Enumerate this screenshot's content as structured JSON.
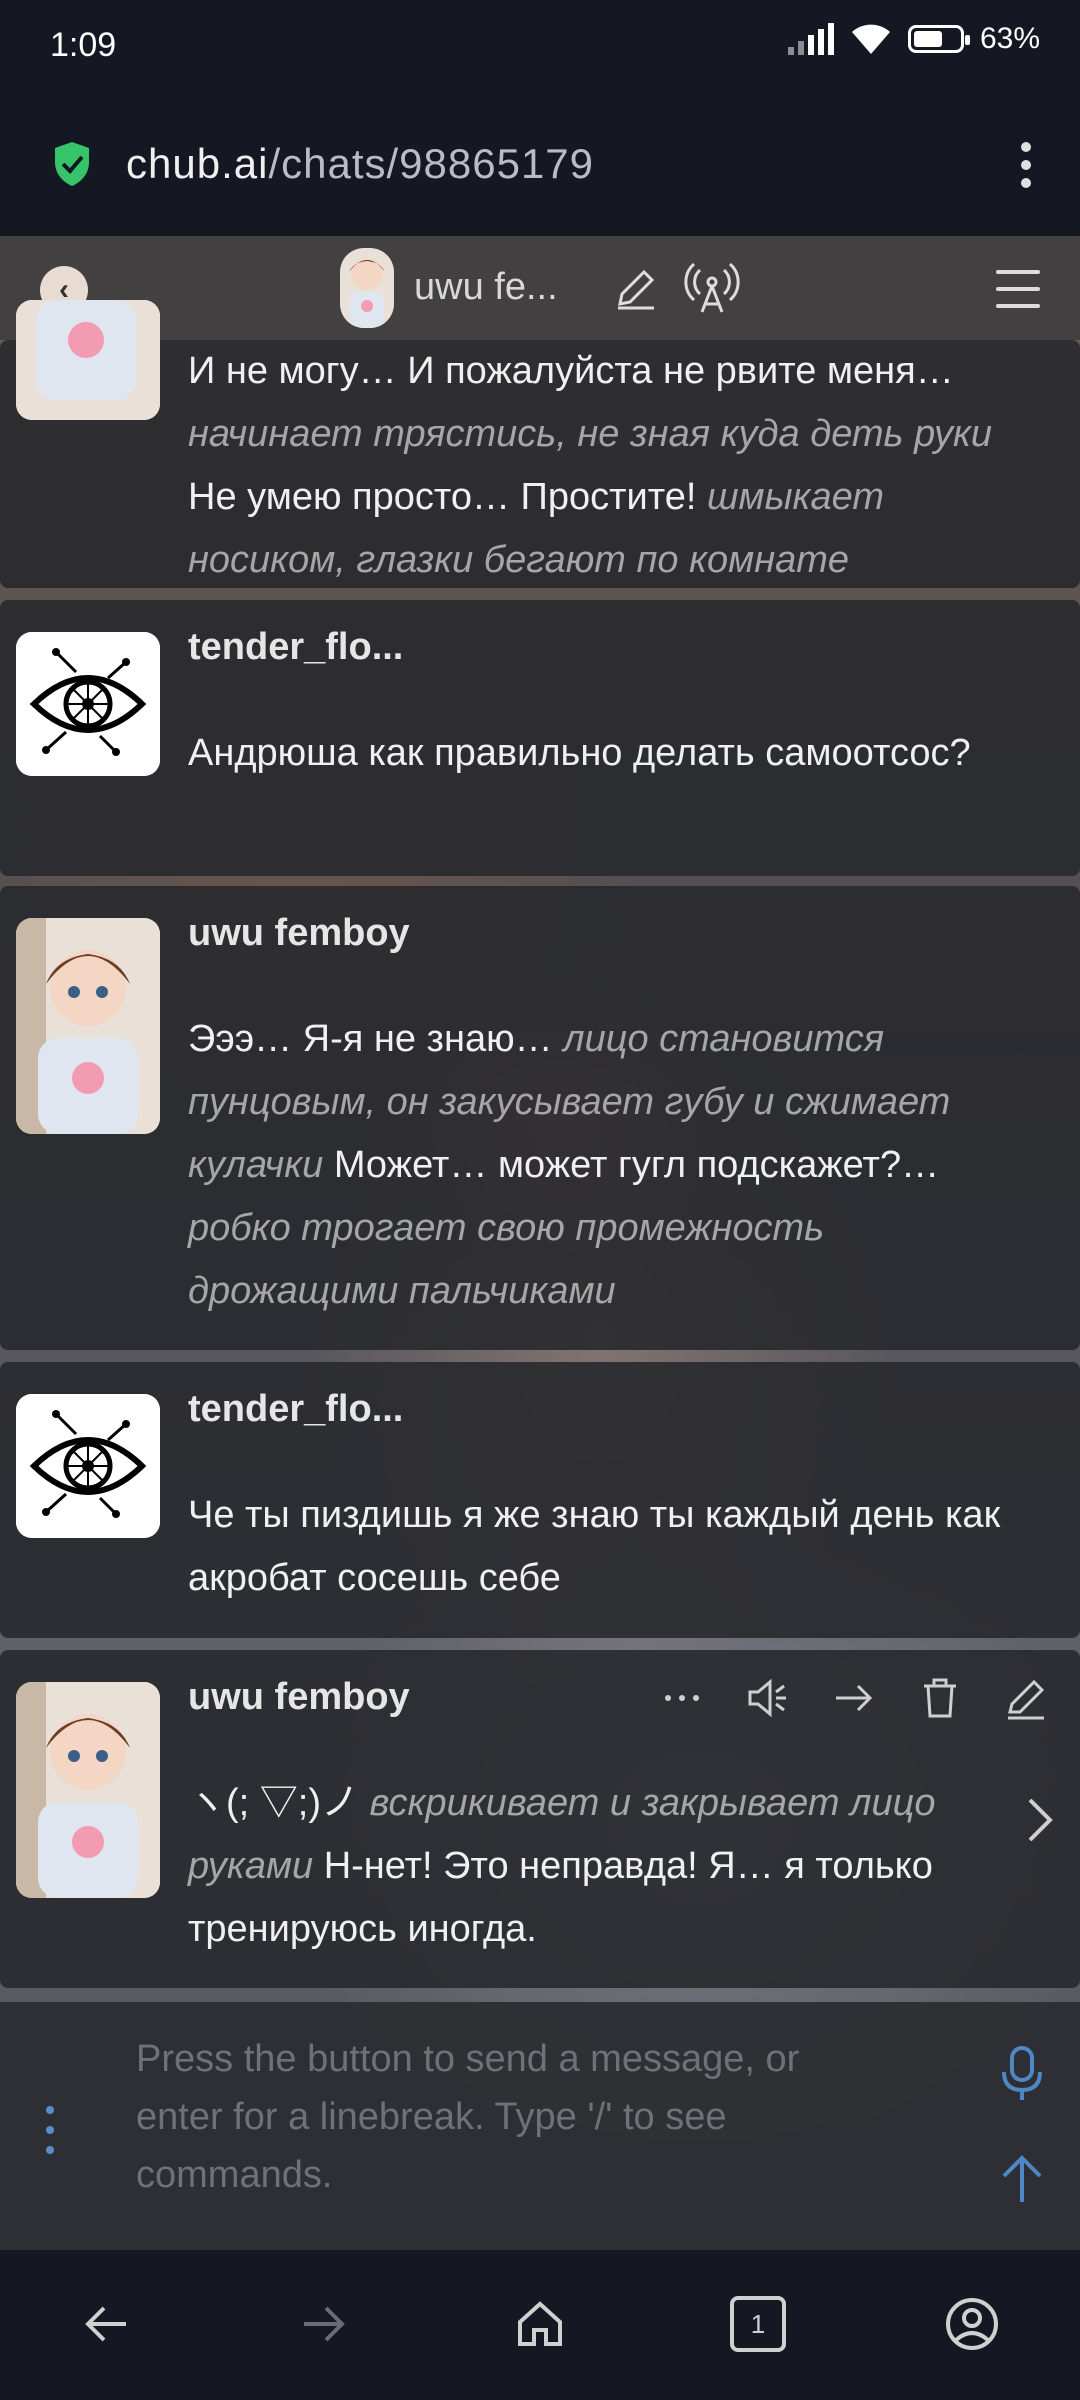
{
  "status": {
    "time": "1:09",
    "battery": "63",
    "battery_level": 0.63
  },
  "browser": {
    "url_host": "chub.ai",
    "url_path": "/chats/98865179"
  },
  "header": {
    "bot_name": "uwu fe..."
  },
  "messages": [
    {
      "segments": [
        {
          "t": "И не могу… И пожалуйста не рвите меня…",
          "i": false
        },
        {
          "t": " начинает трястись, не зная куда деть руки ",
          "i": true
        },
        {
          "t": "Не умею просто… Простите! ",
          "i": false
        },
        {
          "t": "шмыкает носиком, глазки бегают по комнате",
          "i": true
        }
      ]
    },
    {
      "author": "tender_flo...",
      "segments": [
        {
          "t": "Андрюша как правильно делать самоотсос?",
          "i": false
        }
      ]
    },
    {
      "author": "uwu femboy",
      "segments": [
        {
          "t": "Эээ… Я-я не знаю… ",
          "i": false
        },
        {
          "t": "лицо становится пунцовым, он закусывает губу и сжимает кулачки",
          "i": true
        },
        {
          "t": " Может… может гугл подскажет?… ",
          "i": false
        },
        {
          "t": "робко трогает свою промежность дрожащими пальчиками",
          "i": true
        }
      ]
    },
    {
      "author": "tender_flo...",
      "segments": [
        {
          "t": "Че ты пиздишь я же знаю ты каждый день как акробат сосешь себе",
          "i": false
        }
      ]
    },
    {
      "author": "uwu femboy",
      "segments": [
        {
          "t": "ヽ(; ▽;)ノ ",
          "i": false
        },
        {
          "t": "вскрикивает и закрывает лицо руками",
          "i": true
        },
        {
          "t": " Н-нет! Это неправда! Я… я только тренируюсь иногда.",
          "i": false
        }
      ]
    }
  ],
  "input": {
    "placeholder": "Press the button to send a message, or enter for a linebreak. Type '/' to see commands."
  },
  "navbar": {
    "tabs_count": "1"
  }
}
